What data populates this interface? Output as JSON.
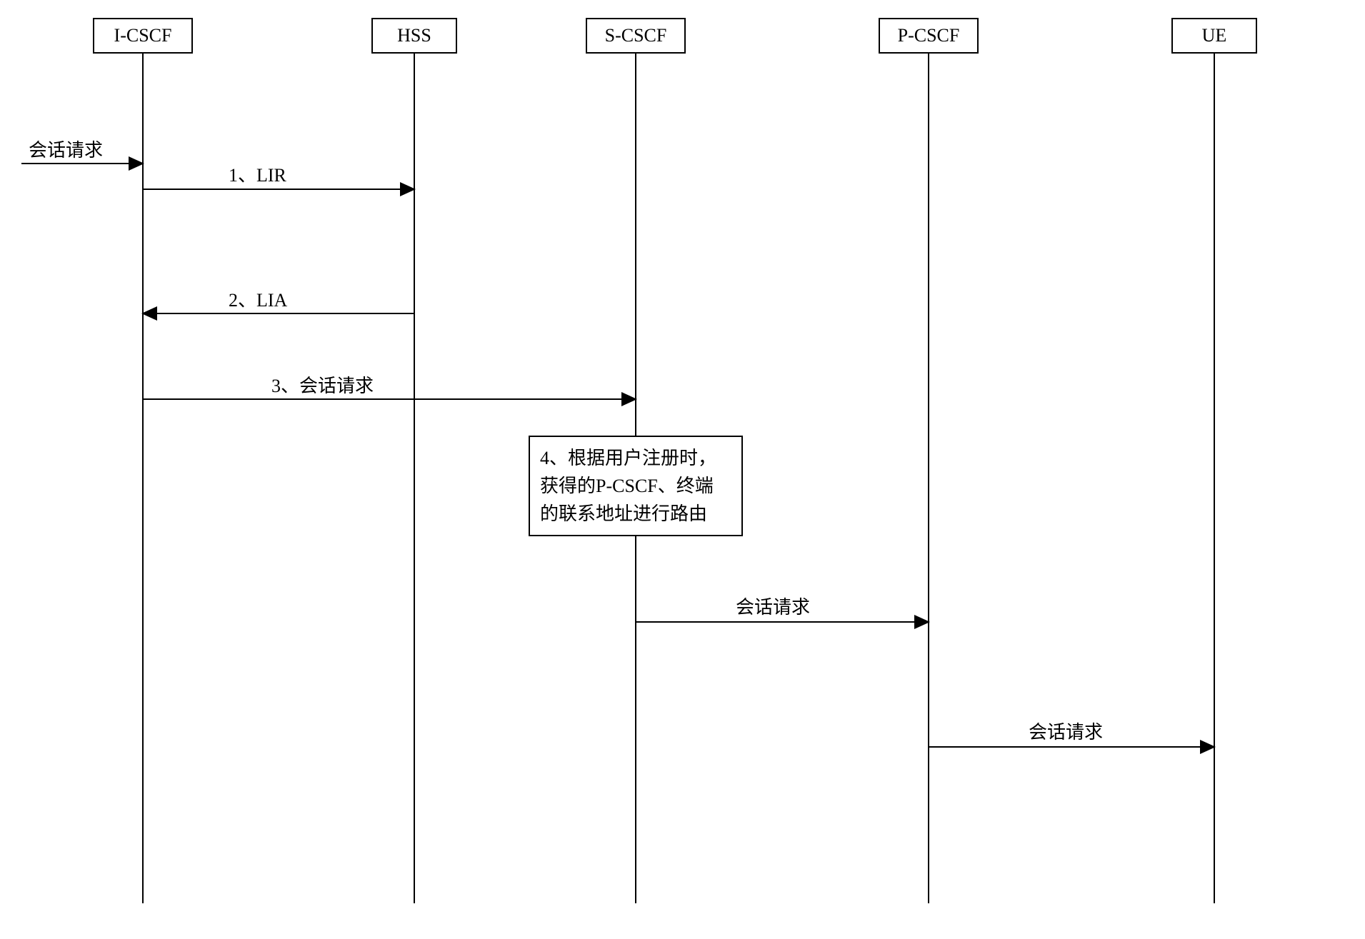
{
  "participants": {
    "p0": "I-CSCF",
    "p1": "HSS",
    "p2": "S-CSCF",
    "p3": "P-CSCF",
    "p4": "UE"
  },
  "messages": {
    "incoming": "会话请求",
    "m1": "1、LIR",
    "m2": "2、LIA",
    "m3": "3、会话请求",
    "m5": "会话请求",
    "m6": "会话请求"
  },
  "notes": {
    "n4_l1": "4、根据用户注册时，",
    "n4_l2": "获得的P-CSCF、终端",
    "n4_l3": "的联系地址进行路由"
  }
}
